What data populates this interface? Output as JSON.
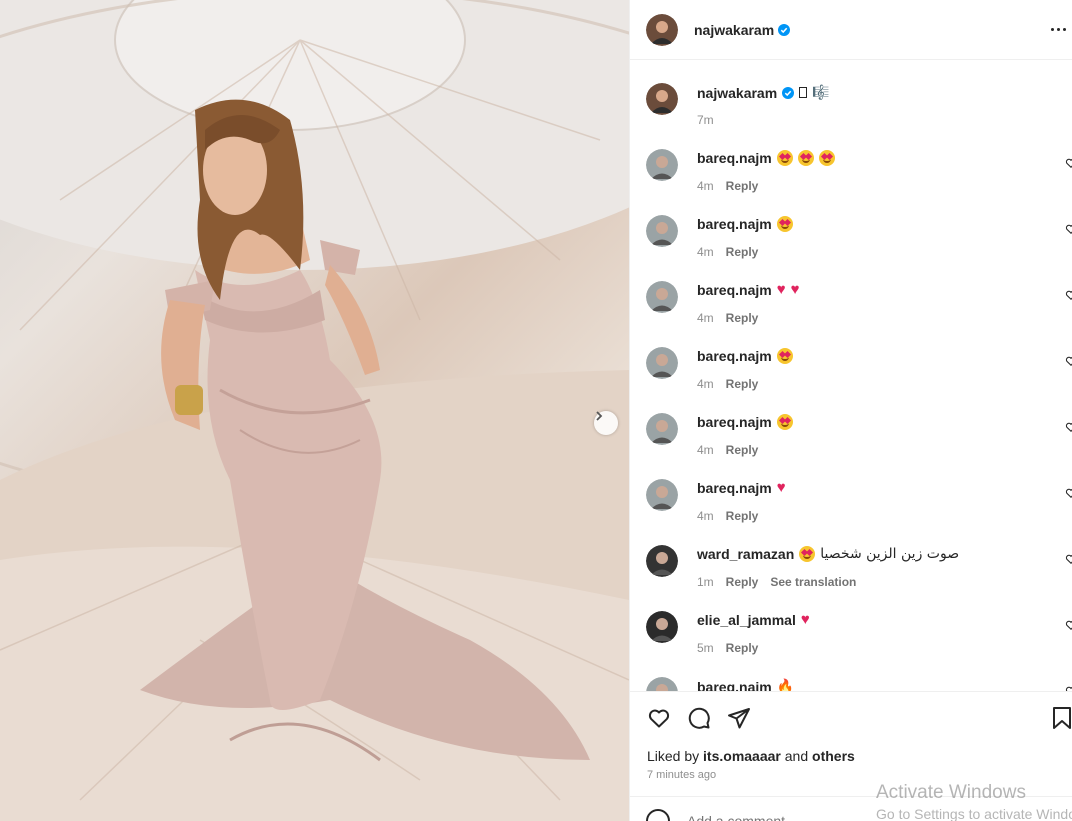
{
  "post": {
    "author": "najwakaram",
    "caption_emoji": "🎼",
    "caption_age": "7m"
  },
  "comments": [
    {
      "user": "bareq.najm",
      "text": "",
      "emoji_count": 3,
      "kind": "starstruck",
      "age": "4m",
      "reply": "Reply"
    },
    {
      "user": "bareq.najm",
      "text": "",
      "emoji_count": 1,
      "kind": "starstruck",
      "age": "4m",
      "reply": "Reply"
    },
    {
      "user": "bareq.najm",
      "text": "",
      "emoji_count": 2,
      "kind": "heart",
      "age": "4m",
      "reply": "Reply"
    },
    {
      "user": "bareq.najm",
      "text": "",
      "emoji_count": 1,
      "kind": "starstruck",
      "age": "4m",
      "reply": "Reply"
    },
    {
      "user": "bareq.najm",
      "text": "",
      "emoji_count": 1,
      "kind": "starstruck",
      "age": "4m",
      "reply": "Reply"
    },
    {
      "user": "bareq.najm",
      "text": "",
      "emoji_count": 1,
      "kind": "heart",
      "age": "4m",
      "reply": "Reply"
    },
    {
      "user": "ward_ramazan",
      "text": "صوت زين الزين شخصيا",
      "emoji_count": 1,
      "kind": "starstruck",
      "age": "1m",
      "reply": "Reply",
      "translate": "See translation"
    },
    {
      "user": "elie_al_jammal",
      "text": "",
      "emoji_count": 1,
      "kind": "heart",
      "age": "5m",
      "reply": "Reply"
    },
    {
      "user": "bareq.najm",
      "text": "🔥",
      "emoji_count": 0,
      "kind": "fire",
      "age": "",
      "reply": ""
    }
  ],
  "likes": {
    "prefix": "Liked by",
    "user": "its.omaaaar",
    "and": "and",
    "others": "others"
  },
  "timestamp": "7 minutes ago",
  "add_comment_placeholder": "Add a comment...",
  "watermark": {
    "line1": "Activate Windows",
    "line2": "Go to Settings to activate Windows."
  },
  "colors": {
    "verified": "#0095f6",
    "heart_red": "#e0245e"
  }
}
